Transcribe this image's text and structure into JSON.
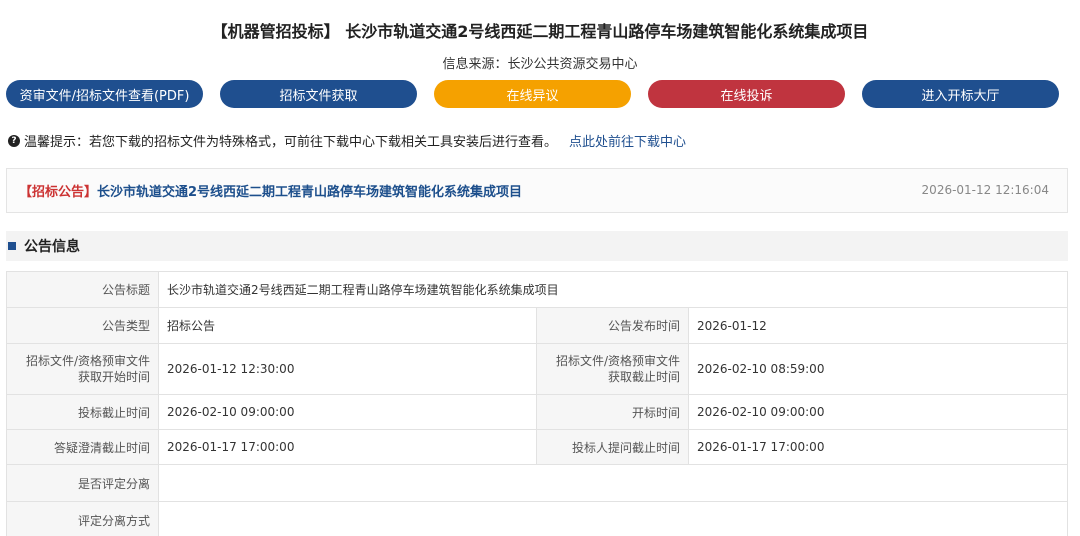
{
  "header": {
    "title": "【机器管招投标】 长沙市轨道交通2号线西延二期工程青山路停车场建筑智能化系统集成项目",
    "source": "信息来源：长沙公共资源交易中心"
  },
  "buttons": [
    {
      "label": "资审文件/招标文件查看(PDF)",
      "color": "#1f4f8f"
    },
    {
      "label": "招标文件获取",
      "color": "#1f4f8f"
    },
    {
      "label": "在线异议",
      "color": "#f5a100"
    },
    {
      "label": "在线投诉",
      "color": "#c0343f"
    },
    {
      "label": "进入开标大厅",
      "color": "#1f4f8f"
    }
  ],
  "tip": {
    "text": "温馨提示：若您下载的招标文件为特殊格式，可前往下载中心下载相关工具安装后进行查看。",
    "link": "点此处前往下载中心"
  },
  "notice": {
    "tag": "【招标公告】",
    "title": "长沙市轨道交通2号线西延二期工程青山路停车场建筑智能化系统集成项目",
    "datetime": "2026-01-12 12:16:04"
  },
  "section": {
    "title": "公告信息"
  },
  "info": {
    "announcement_title_label": "公告标题",
    "announcement_title": "长沙市轨道交通2号线西延二期工程青山路停车场建筑智能化系统集成项目",
    "type_label": "公告类型",
    "type": "招标公告",
    "publish_time_label": "公告发布时间",
    "publish_time": "2026-01-12",
    "doc_start_label_1": "招标文件/资格预审文件",
    "doc_start_label_2": "获取开始时间",
    "doc_start": "2026-01-12 12:30:00",
    "doc_end_label_1": "招标文件/资格预审文件",
    "doc_end_label_2": "获取截止时间",
    "doc_end": "2026-02-10 08:59:00",
    "bid_deadline_label": "投标截止时间",
    "bid_deadline": "2026-02-10 09:00:00",
    "opening_label": "开标时间",
    "opening": "2026-02-10 09:00:00",
    "clarify_deadline_label": "答疑澄清截止时间",
    "clarify_deadline": "2026-01-17 17:00:00",
    "question_deadline_label": "投标人提问截止时间",
    "question_deadline": "2026-01-17 17:00:00",
    "separation_label": "是否评定分离",
    "separation": "",
    "separation_method_label": "评定分离方式",
    "separation_method": ""
  }
}
